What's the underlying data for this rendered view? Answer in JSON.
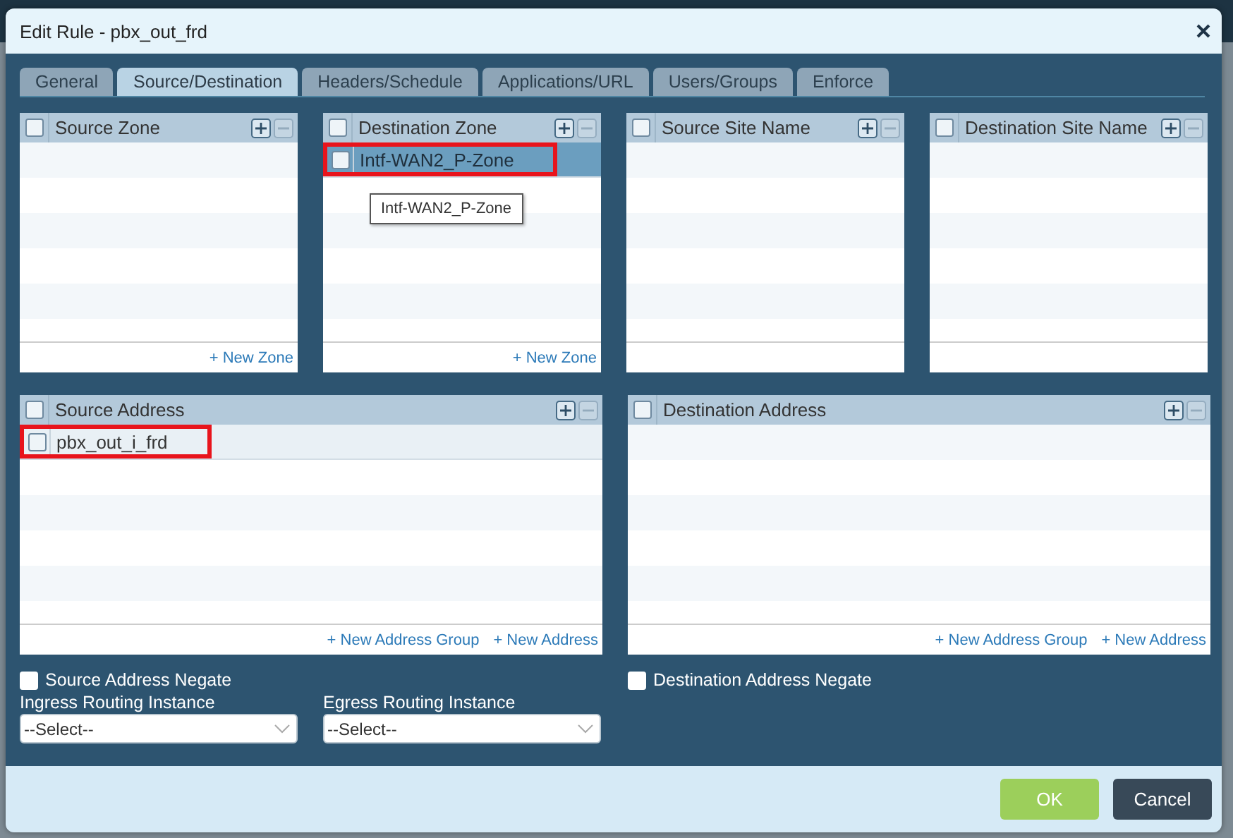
{
  "dialog": {
    "title": "Edit Rule - pbx_out_frd"
  },
  "tabs": [
    {
      "label": "General",
      "selected": false
    },
    {
      "label": "Source/Destination",
      "selected": true
    },
    {
      "label": "Headers/Schedule",
      "selected": false
    },
    {
      "label": "Applications/URL",
      "selected": false
    },
    {
      "label": "Users/Groups",
      "selected": false
    },
    {
      "label": "Enforce",
      "selected": false
    }
  ],
  "zone_panels": [
    {
      "title": "Source Zone",
      "checked": false,
      "links": [
        "+ New Zone"
      ]
    },
    {
      "title": "Destination Zone",
      "checked": false,
      "rows": [
        {
          "label": "Intf-WAN2_P-Zone",
          "checked": false,
          "selected": true,
          "highlighted": true
        }
      ],
      "links": [
        "+ New Zone"
      ],
      "tooltip": "Intf-WAN2_P-Zone"
    },
    {
      "title": "Source Site Name",
      "checked": false
    },
    {
      "title": "Destination Site Name",
      "checked": false
    }
  ],
  "address_panels": [
    {
      "title": "Source Address",
      "checked": false,
      "rows": [
        {
          "label": "pbx_out_i_frd",
          "checked": false,
          "selected": false,
          "highlighted": true
        }
      ],
      "links": [
        "+ New Address Group",
        "+ New Address"
      ]
    },
    {
      "title": "Destination Address",
      "checked": false,
      "links": [
        "+ New Address Group",
        "+ New Address"
      ]
    }
  ],
  "source_options": {
    "negate": {
      "label": "Source Address Negate",
      "checked": false
    },
    "routing": [
      {
        "label": "Ingress Routing Instance",
        "value": "--Select--"
      },
      {
        "label": "Egress Routing Instance",
        "value": "--Select--"
      }
    ]
  },
  "destination_options": {
    "negate": {
      "label": "Destination Address Negate",
      "checked": false
    }
  },
  "buttons": [
    {
      "label": "OK",
      "kind": "primary"
    },
    {
      "label": "Cancel",
      "kind": "secondary"
    }
  ]
}
